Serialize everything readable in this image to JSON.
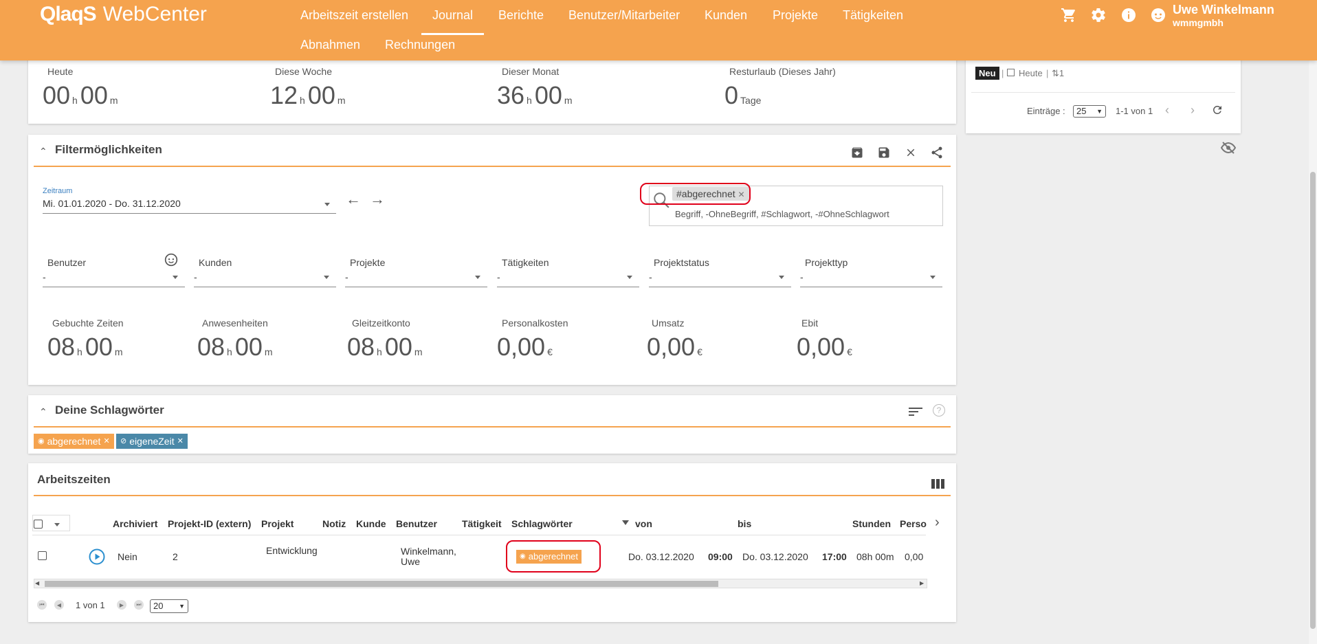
{
  "header": {
    "logo_brand": "QlaqS",
    "logo_product": "WebCenter",
    "nav": [
      {
        "label": "Arbeitszeit erstellen"
      },
      {
        "label": "Journal"
      },
      {
        "label": "Berichte"
      },
      {
        "label": "Benutzer/Mitarbeiter"
      },
      {
        "label": "Kunden"
      },
      {
        "label": "Projekte"
      },
      {
        "label": "Tätigkeiten"
      },
      {
        "label": "Abnahmen"
      },
      {
        "label": "Rechnungen"
      }
    ],
    "active_nav": "Journal",
    "user_name": "Uwe Winkelmann",
    "user_company": "wmmgmbh",
    "icons": [
      "cart-icon",
      "gear-icon",
      "info-icon",
      "smiley-icon"
    ]
  },
  "summary": {
    "items": [
      {
        "label": "Heute",
        "h": "00",
        "m": "00"
      },
      {
        "label": "Diese Woche",
        "h": "12",
        "m": "00"
      },
      {
        "label": "Dieser Monat",
        "h": "36",
        "m": "00"
      },
      {
        "label": "Resturlaub (Dieses Jahr)",
        "value": "0",
        "unit": "Tage"
      }
    ],
    "unit_h": "h",
    "unit_m": "m"
  },
  "side_panel": {
    "new_label": "Neu",
    "today_label": "Heute",
    "count": "1",
    "entries_label": "Einträge :",
    "entries_value": "25",
    "range_text": "1-1 von 1"
  },
  "filter": {
    "title": "Filtermöglichkeiten",
    "period_label": "Zeitraum",
    "period_value": "Mi. 01.01.2020 - Do. 31.12.2020",
    "search_chip": "#abgerechnet",
    "search_hint": "Begriff, -OhneBegriff, #Schlagwort, -#OhneSchlagwort",
    "dropdowns": [
      {
        "label": "Benutzer",
        "value": "-"
      },
      {
        "label": "Kunden",
        "value": "-"
      },
      {
        "label": "Projekte",
        "value": "-"
      },
      {
        "label": "Tätigkeiten",
        "value": "-"
      },
      {
        "label": "Projektstatus",
        "value": "-"
      },
      {
        "label": "Projekttyp",
        "value": "-"
      }
    ],
    "stats": [
      {
        "label": "Gebuchte Zeiten",
        "h": "08",
        "m": "00"
      },
      {
        "label": "Anwesenheiten",
        "h": "08",
        "m": "00"
      },
      {
        "label": "Gleitzeitkonto",
        "h": "08",
        "m": "00"
      },
      {
        "label": "Personalkosten",
        "value": "0,00",
        "unit": "€"
      },
      {
        "label": "Umsatz",
        "value": "0,00",
        "unit": "€"
      },
      {
        "label": "Ebit",
        "value": "0,00",
        "unit": "€"
      }
    ]
  },
  "tags": {
    "title": "Deine Schlagwörter",
    "items": [
      {
        "label": "abgerechnet",
        "color": "#f5a34e"
      },
      {
        "label": "eigeneZeit",
        "color": "#4a88a8"
      }
    ]
  },
  "worktimes": {
    "title": "Arbeitszeiten",
    "columns": [
      "Archiviert",
      "Projekt-ID (extern)",
      "Projekt",
      "Notiz",
      "Kunde",
      "Benutzer",
      "Tätigkeit",
      "Schlagwörter",
      "von",
      "bis",
      "Stunden",
      "Perso"
    ],
    "rows": [
      {
        "archiviert": "Nein",
        "projekt_id": "2",
        "projekt": "Entwicklung",
        "notiz": "",
        "kunde": "",
        "benutzer_line1": "Winkelmann,",
        "benutzer_line2": "Uwe",
        "taetigkeit": "",
        "schlagwort": "abgerechnet",
        "von_date": "Do. 03.12.2020",
        "von_time": "09:00",
        "bis_date": "Do. 03.12.2020",
        "bis_time": "17:00",
        "stunden": "08h 00m",
        "perso": "0,00"
      }
    ],
    "pager_text": "1 von 1",
    "page_size": "20"
  }
}
